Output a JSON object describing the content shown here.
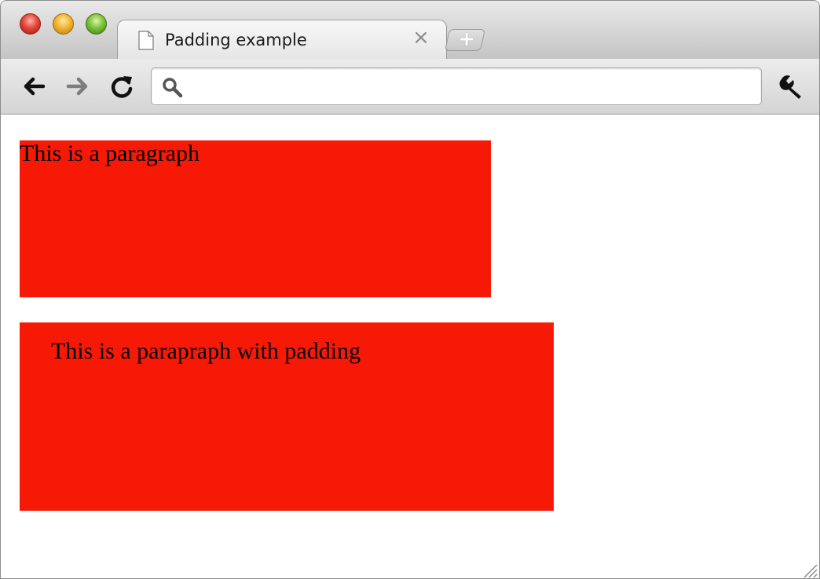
{
  "window": {
    "tab": {
      "title": "Padding example",
      "close_glyph": "×"
    },
    "new_tab_glyph": "+",
    "icons": {
      "back": "back-arrow-icon",
      "forward": "forward-arrow-icon",
      "reload": "reload-icon",
      "search": "search-icon",
      "wrench": "wrench-icon",
      "document": "document-icon"
    },
    "omnibox": {
      "value": "",
      "placeholder": ""
    }
  },
  "page": {
    "paragraphs": [
      {
        "text": "This is a paragraph"
      },
      {
        "text": "This is a parapraph with padding"
      }
    ]
  },
  "colors": {
    "paragraph_background": "#f61905",
    "traffic_close": "#e2463b",
    "traffic_minimize": "#f3b331",
    "traffic_zoom": "#7ec23a"
  }
}
